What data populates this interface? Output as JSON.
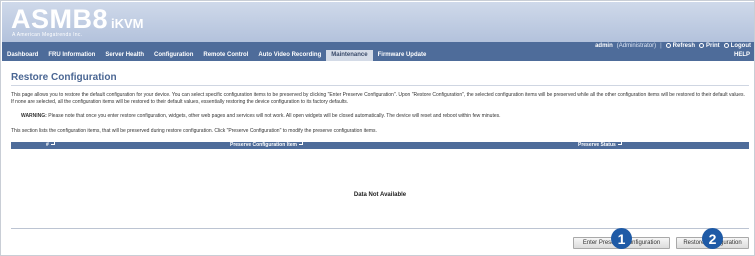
{
  "header": {
    "logo": "ASMB8",
    "logo_suffix": "iKVM",
    "logo_sub": "A American Megatrends Inc."
  },
  "userbar": {
    "user": "admin",
    "role": "(Administrator)",
    "refresh": "Refresh",
    "print": "Print",
    "logout": "Logout"
  },
  "nav": {
    "items": [
      "Dashboard",
      "FRU Information",
      "Server Health",
      "Configuration",
      "Remote Control",
      "Auto Video Recording",
      "Maintenance",
      "Firmware Update"
    ],
    "help": "HELP"
  },
  "page": {
    "title": "Restore Configuration",
    "desc": "This page allows you to restore the default configuration for your device. You can select specific configuration items to be preserved by clicking \"Enter Preserve Configuration\". Upon \"Restore Configuration\", the selected configuration items will be preserved while all the other configuration items will be restored to their default values. If none are selected, all the configuration items will be restored to their default values, essentially restoring the device configuration to its factory defaults.",
    "warning_label": "WARNING:",
    "warning_text": "Please note that once you enter restore configuration, widgets, other web pages and services will not work. All open widgets will be closed automatically. The device will reset and reboot within few minutes.",
    "section_text": "This section lists the configuration items, that will be preserved during restore configuration. Click \"Preserve Configuration\" to modify the preserve configuration items."
  },
  "table": {
    "columns": [
      "#",
      "Preserve Configuration Item",
      "Preserve Status"
    ],
    "empty": "Data Not Available"
  },
  "buttons": {
    "enter_preserve": "Enter Preserve Configuration",
    "restore": "Restore Configuration"
  },
  "callouts": [
    "1",
    "2"
  ],
  "colors": {
    "header": "#b3c2dc",
    "nav": "#4e6c9a",
    "title": "#4a6693",
    "callout": "#1e5aa6"
  }
}
